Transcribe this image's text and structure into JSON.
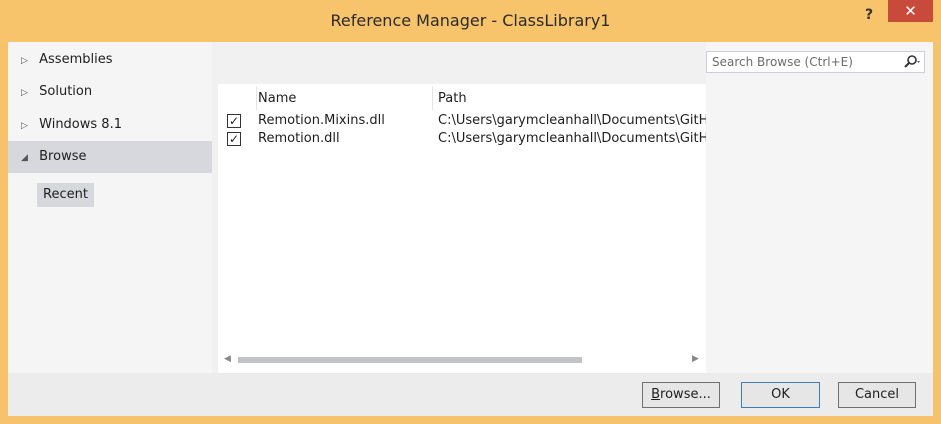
{
  "window": {
    "title": "Reference Manager - ClassLibrary1",
    "help_label": "?",
    "close_label": "✕"
  },
  "sidebar": {
    "items": [
      {
        "label": "Assemblies",
        "expanded": false
      },
      {
        "label": "Solution",
        "expanded": false
      },
      {
        "label": "Windows 8.1",
        "expanded": false
      },
      {
        "label": "Browse",
        "expanded": true,
        "selected": true
      }
    ],
    "sub_item": "Recent",
    "collapsed_arrow": "▷",
    "expanded_arrow": "◢"
  },
  "search": {
    "placeholder": "Search Browse (Ctrl+E)",
    "icon": "search-icon"
  },
  "table": {
    "columns": [
      "Name",
      "Path"
    ],
    "rows": [
      {
        "checked": true,
        "name": "Remotion.Mixins.dll",
        "path": "C:\\Users\\garymcleanhall\\Documents\\GitH"
      },
      {
        "checked": true,
        "name": "Remotion.dll",
        "path": "C:\\Users\\garymcleanhall\\Documents\\GitH"
      }
    ],
    "check_glyph": "✓"
  },
  "footer": {
    "browse_prefix": "",
    "browse_underlined": "B",
    "browse_rest": "rowse...",
    "ok_label": "OK",
    "cancel_label": "Cancel"
  },
  "colors": {
    "title_bar": "#f7c46b",
    "close_button": "#c74a3b",
    "selection": "#d6d8dd"
  }
}
